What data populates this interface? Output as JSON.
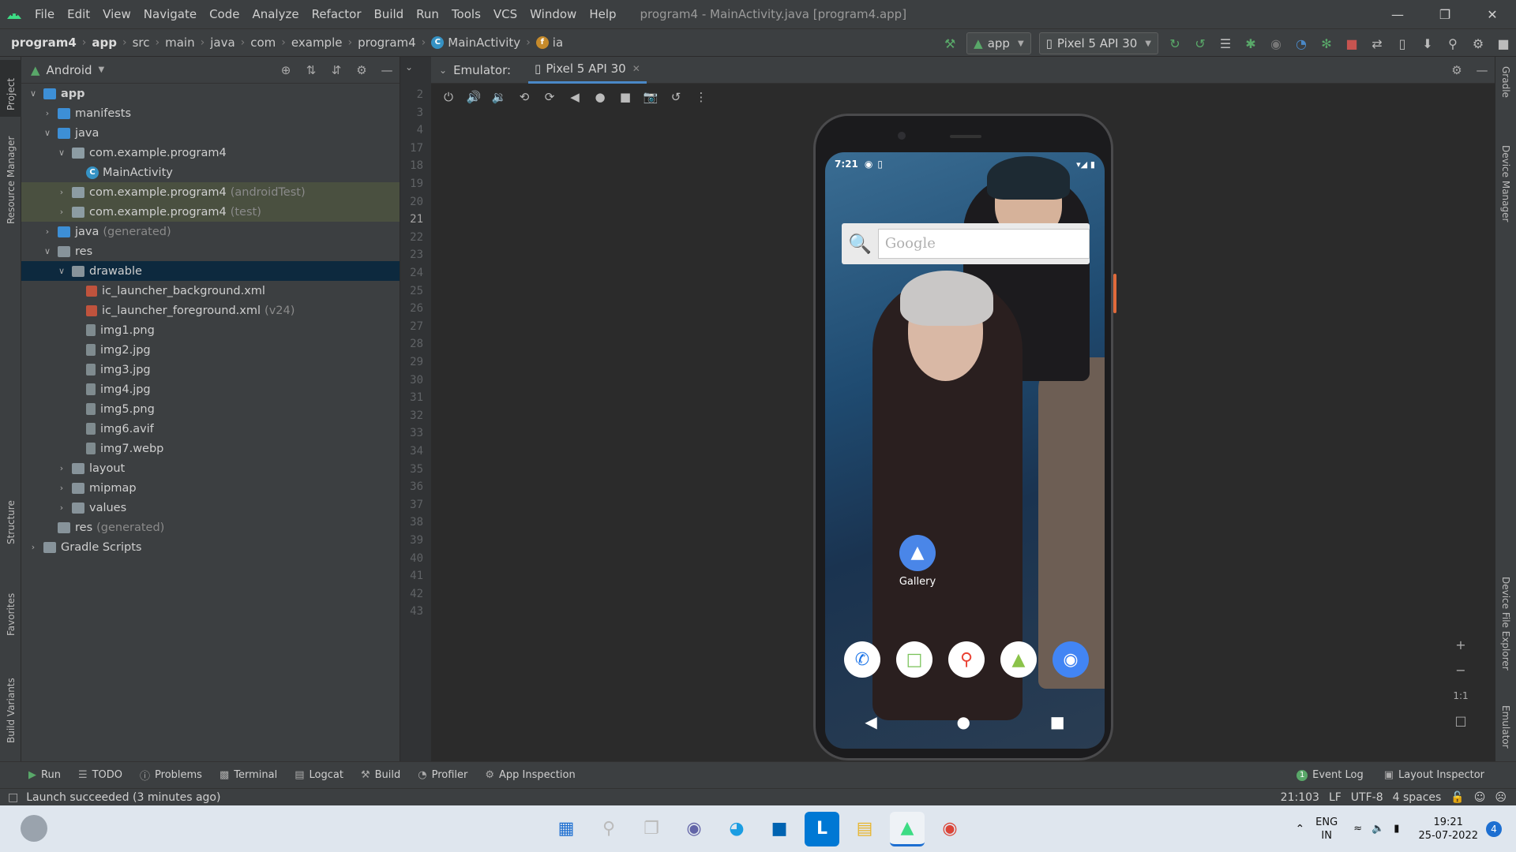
{
  "window": {
    "menus": [
      "File",
      "Edit",
      "View",
      "Navigate",
      "Code",
      "Analyze",
      "Refactor",
      "Build",
      "Run",
      "Tools",
      "VCS",
      "Window",
      "Help"
    ],
    "title": "program4 - MainActivity.java [program4.app]"
  },
  "breadcrumb": [
    "program4",
    "app",
    "src",
    "main",
    "java",
    "com",
    "example",
    "program4",
    "MainActivity",
    "ia"
  ],
  "toolbar": {
    "config": "app",
    "device": "Pixel 5 API 30"
  },
  "project": {
    "view": "Android",
    "tree": [
      {
        "label": "app",
        "depth": 0,
        "chevron": "down",
        "icon": "fold blue",
        "bold": true
      },
      {
        "label": "manifests",
        "depth": 1,
        "chevron": "right",
        "icon": "fold blue"
      },
      {
        "label": "java",
        "depth": 1,
        "chevron": "down",
        "icon": "fold blue"
      },
      {
        "label": "com.example.program4",
        "depth": 2,
        "chevron": "down",
        "icon": "fold pkg"
      },
      {
        "label": "MainActivity",
        "depth": 3,
        "chevron": "",
        "icon": "class"
      },
      {
        "label": "com.example.program4",
        "suffix": "(androidTest)",
        "depth": 2,
        "chevron": "right",
        "icon": "fold pkg",
        "state": "hl"
      },
      {
        "label": "com.example.program4",
        "suffix": "(test)",
        "depth": 2,
        "chevron": "right",
        "icon": "fold pkg",
        "state": "hl"
      },
      {
        "label": "java",
        "suffix": "(generated)",
        "depth": 1,
        "chevron": "right",
        "icon": "fold blue"
      },
      {
        "label": "res",
        "depth": 1,
        "chevron": "down",
        "icon": "fold"
      },
      {
        "label": "drawable",
        "depth": 2,
        "chevron": "down",
        "icon": "fold",
        "state": "sel"
      },
      {
        "label": "ic_launcher_background.xml",
        "depth": 3,
        "chevron": "",
        "icon": "xml"
      },
      {
        "label": "ic_launcher_foreground.xml",
        "suffix": "(v24)",
        "depth": 3,
        "chevron": "",
        "icon": "xml"
      },
      {
        "label": "img1.png",
        "depth": 3,
        "chevron": "",
        "icon": "file"
      },
      {
        "label": "img2.jpg",
        "depth": 3,
        "chevron": "",
        "icon": "file"
      },
      {
        "label": "img3.jpg",
        "depth": 3,
        "chevron": "",
        "icon": "file"
      },
      {
        "label": "img4.jpg",
        "depth": 3,
        "chevron": "",
        "icon": "file"
      },
      {
        "label": "img5.png",
        "depth": 3,
        "chevron": "",
        "icon": "file"
      },
      {
        "label": "img6.avif",
        "depth": 3,
        "chevron": "",
        "icon": "file"
      },
      {
        "label": "img7.webp",
        "depth": 3,
        "chevron": "",
        "icon": "file"
      },
      {
        "label": "layout",
        "depth": 2,
        "chevron": "right",
        "icon": "fold"
      },
      {
        "label": "mipmap",
        "depth": 2,
        "chevron": "right",
        "icon": "fold"
      },
      {
        "label": "values",
        "depth": 2,
        "chevron": "right",
        "icon": "fold"
      },
      {
        "label": "res",
        "suffix": "(generated)",
        "depth": 1,
        "chevron": "",
        "icon": "fold"
      },
      {
        "label": "Gradle Scripts",
        "depth": 0,
        "chevron": "right",
        "icon": "fold"
      }
    ]
  },
  "gutter": {
    "lines": [
      "2",
      "3",
      "4",
      "17",
      "18",
      "19",
      "20",
      "21",
      "22",
      "23",
      "24",
      "25",
      "26",
      "27",
      "28",
      "29",
      "30",
      "31",
      "32",
      "33",
      "34",
      "35",
      "36",
      "37",
      "38",
      "39",
      "40",
      "41",
      "42",
      "43"
    ],
    "current": "21"
  },
  "emulator": {
    "label": "Emulator:",
    "tab": "Pixel 5 API 30"
  },
  "phone": {
    "time": "7:21",
    "search_placeholder": "Google",
    "gallery_label": "Gallery",
    "dock_icons": [
      "phone-icon",
      "market-icon",
      "maps-icon",
      "android-icon",
      "camera-icon"
    ]
  },
  "left_tabs": [
    "Project",
    "Resource Manager",
    "Structure",
    "Favorites",
    "Build Variants"
  ],
  "right_tabs": [
    "Gradle",
    "Device Manager",
    "Device File Explorer",
    "Emulator"
  ],
  "bottom_tools": [
    "Run",
    "TODO",
    "Problems",
    "Terminal",
    "Logcat",
    "Build",
    "Profiler",
    "App Inspection"
  ],
  "bottom_right": [
    "Event Log",
    "Layout Inspector"
  ],
  "event_log_count": "1",
  "status": {
    "message": "Launch succeeded (3 minutes ago)",
    "position": "21:103",
    "line_sep": "LF",
    "encoding": "UTF-8",
    "indent": "4 spaces"
  },
  "taskbar": {
    "lang_top": "ENG",
    "lang_bottom": "IN",
    "time": "19:21",
    "date": "25-07-2022",
    "notifications": "4"
  },
  "colors": {
    "accent": "#4a88c7",
    "selection": "#0d293e",
    "vcs_highlight": "#4a5040",
    "run_green": "#59a869",
    "stop_red": "#c75450"
  }
}
